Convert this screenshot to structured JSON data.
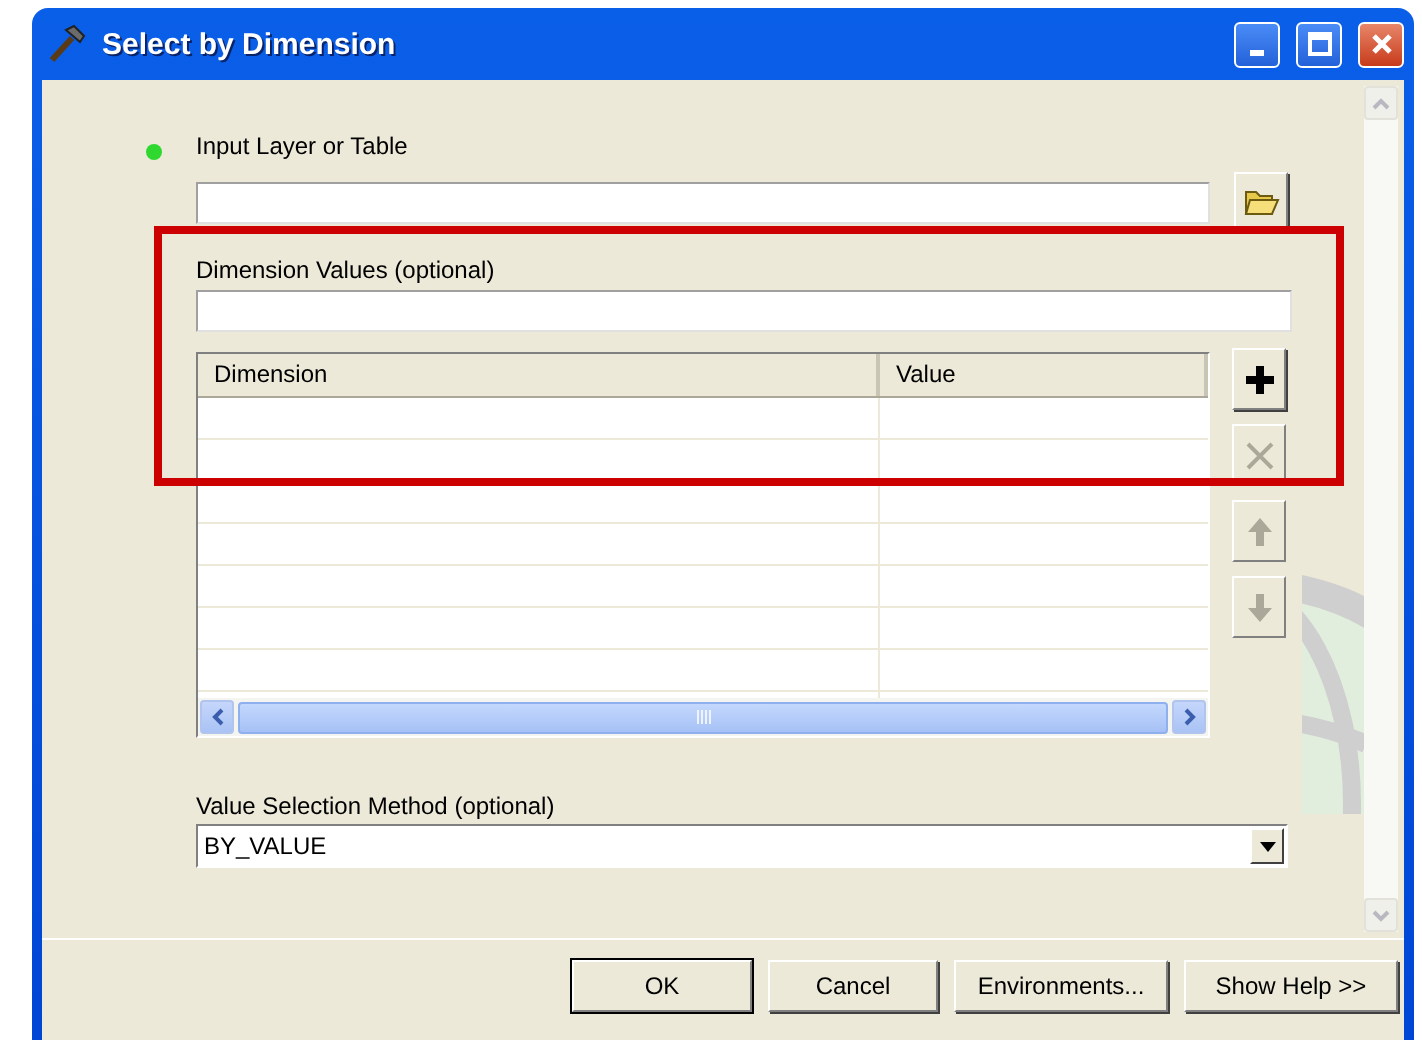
{
  "window": {
    "title": "Select by Dimension"
  },
  "input_layer": {
    "label": "Input Layer or Table",
    "required": true
  },
  "dimension_values": {
    "label": "Dimension Values (optional)",
    "highlighted": true
  },
  "table": {
    "columns": [
      "Dimension",
      "Value"
    ]
  },
  "table_buttons": [
    {
      "kind": "add",
      "disabled": false
    },
    {
      "kind": "remove",
      "disabled": true
    },
    {
      "kind": "up",
      "disabled": true
    },
    {
      "kind": "down",
      "disabled": true
    }
  ],
  "value_selection_method": {
    "label": "Value Selection Method (optional)",
    "value": "BY_VALUE"
  },
  "buttons": [
    {
      "label": "OK",
      "default": true
    },
    {
      "label": "Cancel",
      "default": false
    },
    {
      "label": "Environments...",
      "default": false
    },
    {
      "label": "Show Help >>",
      "default": false
    }
  ]
}
